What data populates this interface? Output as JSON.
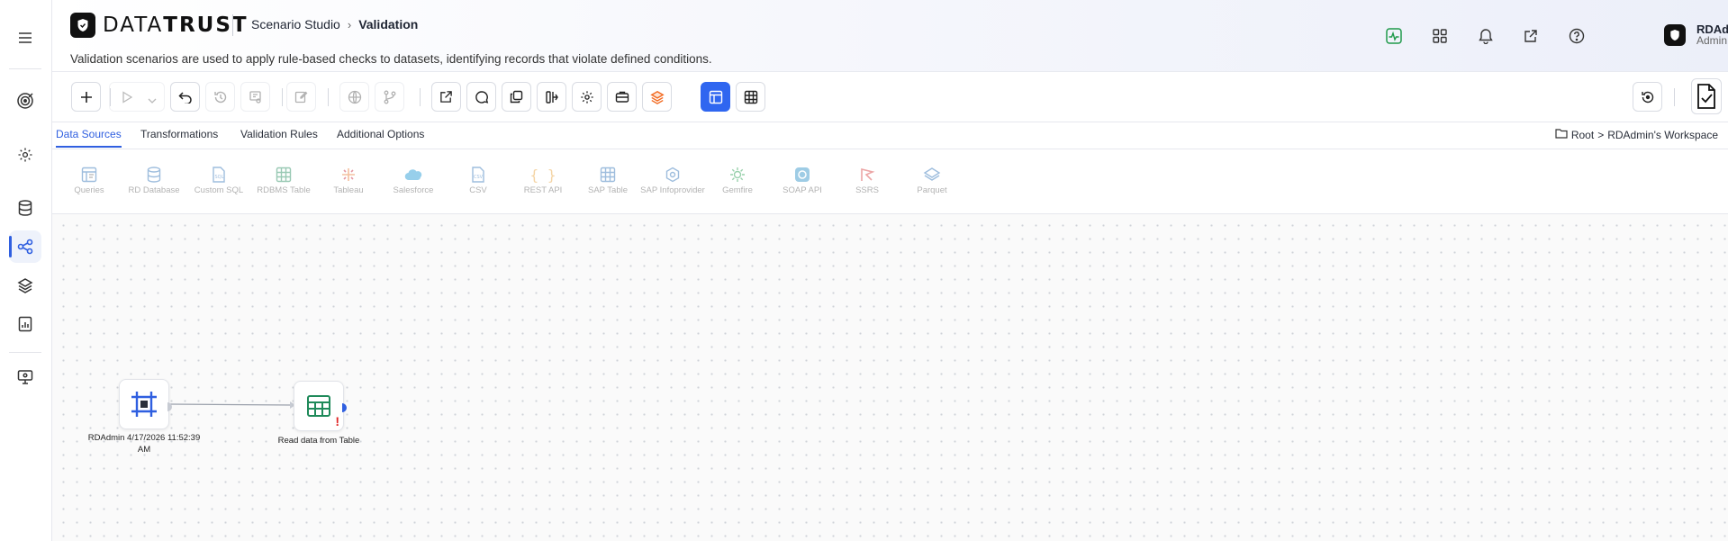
{
  "app": {
    "logo_text_a": "DATA",
    "logo_text_b": "TRUST",
    "breadcrumb": {
      "parent": "Scenario Studio",
      "current": "Validation"
    },
    "subtitle": "Validation scenarios are used to apply rule-based checks to datasets, identifying records that violate defined conditions."
  },
  "header_icons": [
    "activity-icon",
    "apps-grid-icon",
    "bell-icon",
    "external-link-icon",
    "help-icon"
  ],
  "user": {
    "name": "RDAdmin",
    "role": "Admin"
  },
  "sidebar": {
    "items": [
      "menu-icon",
      "target-icon",
      "gear-icon",
      "database-icon",
      "workflow-icon",
      "layers-icon",
      "report-icon",
      "monitor-settings-icon"
    ],
    "active": "workflow-icon"
  },
  "tabs": [
    {
      "label": "Data Sources",
      "active": true
    },
    {
      "label": "Transformations",
      "active": false
    },
    {
      "label": "Validation Rules",
      "active": false
    },
    {
      "label": "Additional Options",
      "active": false
    }
  ],
  "path": {
    "root": "Root",
    "workspace": "RDAdmin's Workspace"
  },
  "palette": [
    {
      "label": "Queries",
      "icon": "queries-icon"
    },
    {
      "label": "RD Database",
      "icon": "database-icon"
    },
    {
      "label": "Custom SQL",
      "icon": "sql-file-icon"
    },
    {
      "label": "RDBMS Table",
      "icon": "table-icon"
    },
    {
      "label": "Tableau",
      "icon": "tableau-icon"
    },
    {
      "label": "Salesforce",
      "icon": "cloud-icon"
    },
    {
      "label": "CSV",
      "icon": "csv-file-icon"
    },
    {
      "label": "REST API",
      "icon": "braces-icon"
    },
    {
      "label": "SAP Table",
      "icon": "table-icon"
    },
    {
      "label": "SAP Infoprovider",
      "icon": "hexagon-icon"
    },
    {
      "label": "Gemfire",
      "icon": "gemfire-icon"
    },
    {
      "label": "SOAP API",
      "icon": "soap-icon"
    },
    {
      "label": "SSRS",
      "icon": "ssrs-icon"
    },
    {
      "label": "Parquet",
      "icon": "parquet-icon"
    }
  ],
  "nodes": {
    "source_label": "RDAdmin 4/17/2026 11:52:39 AM",
    "table_label": "Read data from Table",
    "table_warning": "!"
  },
  "colors": {
    "accent": "#2f66f0",
    "source_node": "#2f5fe0",
    "table_node": "#1f8a5a",
    "warning": "#e02424"
  }
}
